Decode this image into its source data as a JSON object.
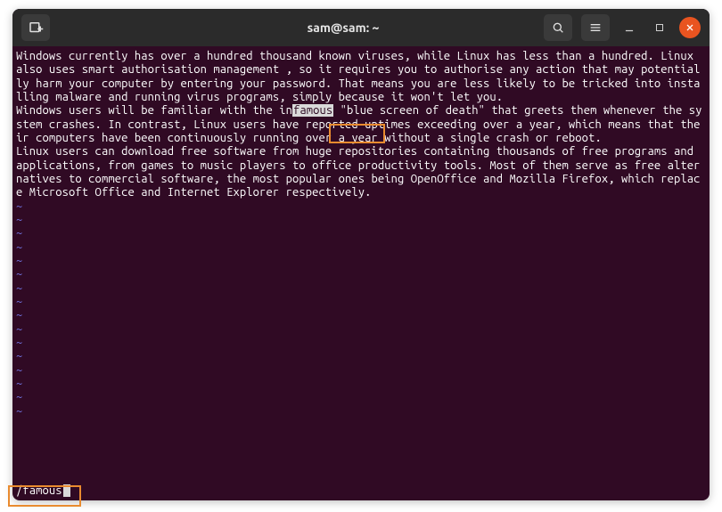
{
  "window": {
    "title": "sam@sam: ~"
  },
  "icons": {
    "newtab": "new-tab",
    "search": "search",
    "menu": "menu",
    "minimize": "minimize",
    "maximize": "maximize",
    "close": "close"
  },
  "text": {
    "p1": "Windows currently has over a hundred thousand known viruses, while Linux has less than a hundred. Linux also uses smart authorisation management , so it requires you to authorise any action that may potentially harm your computer by entering your password. That means you are less likely to be tricked into installing malware and running virus programs, simply because it won't let you.",
    "p2a": "Windows users will be familiar with the in",
    "p2_match": "famous",
    "p2b": " \"blue screen of death\" that greets them whenever the system crashes. In contrast, Linux users have reported uptimes exceeding over a year, which means that their computers have been continuously running over a year without a single crash or reboot.",
    "p3": "Linux users can download free software from huge repositories containing thousands of free programs and applications, from games to music players to office productivity tools. Most of them serve as free alternatives to commercial software, the most popular ones being OpenOffice and Mozilla Firefox, which replace Microsoft Office and Internet Explorer respectively."
  },
  "tilde": "~",
  "command": {
    "prefix": "/",
    "pattern": "famous"
  }
}
